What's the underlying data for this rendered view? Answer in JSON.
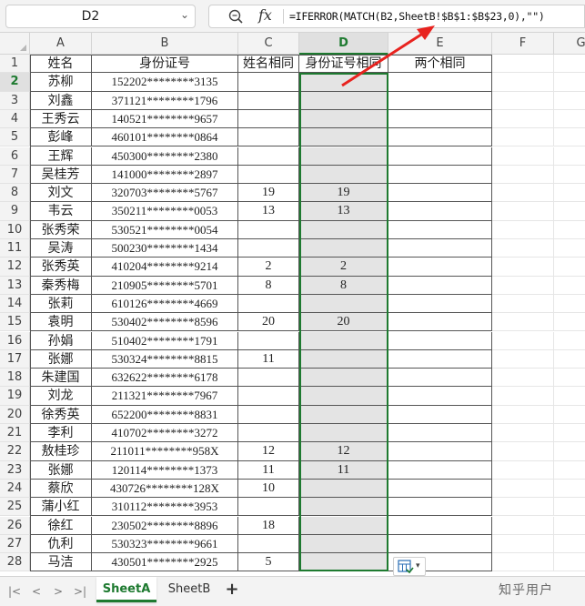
{
  "formula_bar": {
    "name_box": "D2",
    "fx_label": "fx",
    "formula": "=IFERROR(MATCH(B2,SheetB!$B$1:$B$23,0),\"\")"
  },
  "columns": [
    "A",
    "B",
    "C",
    "D",
    "E",
    "F",
    "G"
  ],
  "selected_column": "D",
  "selected_row": 2,
  "row_numbers": [
    "1",
    "2",
    "3",
    "4",
    "5",
    "6",
    "7",
    "8",
    "9",
    "10",
    "11",
    "12",
    "13",
    "14",
    "15",
    "16",
    "17",
    "18",
    "19",
    "20",
    "21",
    "22",
    "23",
    "24",
    "25",
    "26",
    "27",
    "28"
  ],
  "headers": {
    "name": "姓名",
    "id": "身份证号",
    "name_match": "姓名相同",
    "id_match": "身份证号相同",
    "both_match": "两个相同"
  },
  "rows": [
    {
      "name": "苏柳",
      "id": "152202********3135",
      "c": "",
      "d": ""
    },
    {
      "name": "刘鑫",
      "id": "371121********1796",
      "c": "",
      "d": ""
    },
    {
      "name": "王秀云",
      "id": "140521********9657",
      "c": "",
      "d": ""
    },
    {
      "name": "彭峰",
      "id": "460101********0864",
      "c": "",
      "d": ""
    },
    {
      "name": "王辉",
      "id": "450300********2380",
      "c": "",
      "d": ""
    },
    {
      "name": "吴桂芳",
      "id": "141000********2897",
      "c": "",
      "d": ""
    },
    {
      "name": "刘文",
      "id": "320703********5767",
      "c": "19",
      "d": "19"
    },
    {
      "name": "韦云",
      "id": "350211********0053",
      "c": "13",
      "d": "13"
    },
    {
      "name": "张秀荣",
      "id": "530521********0054",
      "c": "",
      "d": ""
    },
    {
      "name": "吴涛",
      "id": "500230********1434",
      "c": "",
      "d": ""
    },
    {
      "name": "张秀英",
      "id": "410204********9214",
      "c": "2",
      "d": "2"
    },
    {
      "name": "秦秀梅",
      "id": "210905********5701",
      "c": "8",
      "d": "8"
    },
    {
      "name": "张莉",
      "id": "610126********4669",
      "c": "",
      "d": ""
    },
    {
      "name": "袁明",
      "id": "530402********8596",
      "c": "20",
      "d": "20"
    },
    {
      "name": "孙娟",
      "id": "510402********1791",
      "c": "",
      "d": ""
    },
    {
      "name": "张娜",
      "id": "530324********8815",
      "c": "11",
      "d": ""
    },
    {
      "name": "朱建国",
      "id": "632622********6178",
      "c": "",
      "d": ""
    },
    {
      "name": "刘龙",
      "id": "211321********7967",
      "c": "",
      "d": ""
    },
    {
      "name": "徐秀英",
      "id": "652200********8831",
      "c": "",
      "d": ""
    },
    {
      "name": "李利",
      "id": "410702********3272",
      "c": "",
      "d": ""
    },
    {
      "name": "敖桂珍",
      "id": "211011********958X",
      "c": "12",
      "d": "12"
    },
    {
      "name": "张娜",
      "id": "120114********1373",
      "c": "11",
      "d": "11"
    },
    {
      "name": "蔡欣",
      "id": "430726********128X",
      "c": "10",
      "d": ""
    },
    {
      "name": "蒲小红",
      "id": "310112********3953",
      "c": "",
      "d": ""
    },
    {
      "name": "徐红",
      "id": "230502********8896",
      "c": "18",
      "d": ""
    },
    {
      "name": "仇利",
      "id": "530323********9661",
      "c": "",
      "d": ""
    },
    {
      "name": "马洁",
      "id": "430501********2925",
      "c": "5",
      "d": ""
    }
  ],
  "sheets": [
    {
      "label": "SheetA",
      "active": true
    },
    {
      "label": "SheetB",
      "active": false
    }
  ],
  "watermark": "知乎用户",
  "colors": {
    "accent_green": "#1e7a30",
    "arrow_red": "#e8231f"
  }
}
